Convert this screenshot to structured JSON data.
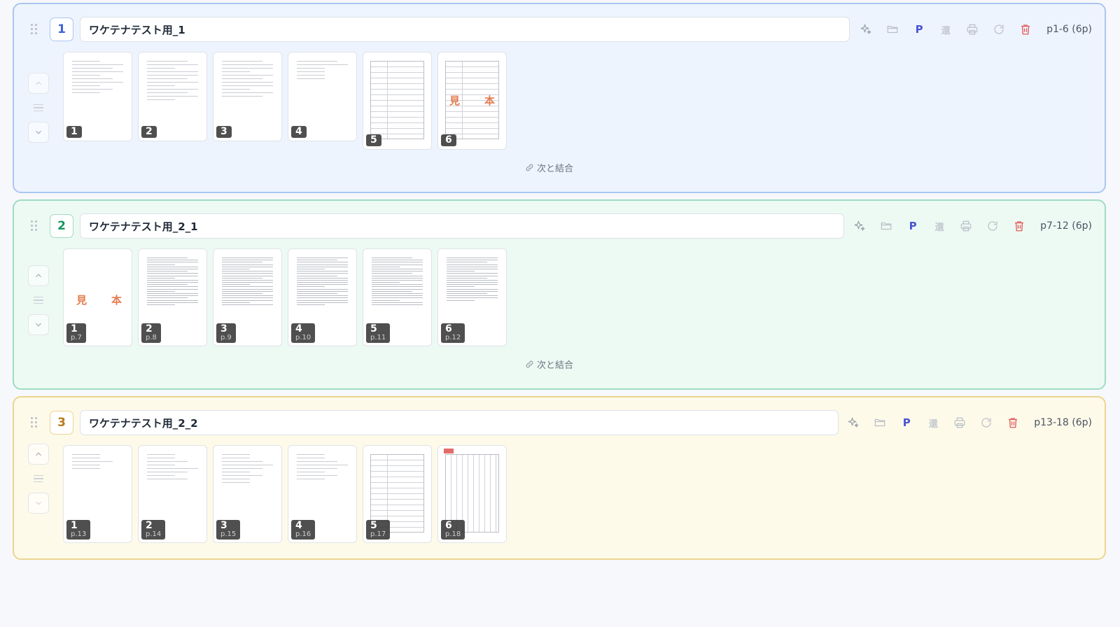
{
  "colors": {
    "blue_border": "#a9c6f3",
    "green_border": "#9fdcc0",
    "yellow_border": "#ecd58f",
    "delete": "#e25b5b",
    "p_button": "#4a55d3"
  },
  "icons": [
    "drag-handle-icon",
    "sparkle-icon",
    "folder-icon",
    "p-icon",
    "kanji-icon",
    "print-icon",
    "refresh-icon",
    "trash-icon",
    "chevron-up-icon",
    "chevron-down-icon",
    "link-icon"
  ],
  "groups": [
    {
      "number": "1",
      "name": "ワケテナテスト用_1",
      "range": "p1-6 (6p)",
      "p_label": "P",
      "kanji_label": "還",
      "join_label": "次と結合",
      "pages": [
        {
          "num": "1",
          "page": ""
        },
        {
          "num": "2",
          "page": ""
        },
        {
          "num": "3",
          "page": ""
        },
        {
          "num": "4",
          "page": ""
        },
        {
          "num": "5",
          "page": ""
        },
        {
          "num": "6",
          "page": ""
        }
      ],
      "stamps": [
        "見",
        "本"
      ]
    },
    {
      "number": "2",
      "name": "ワケテナテスト用_2_1",
      "range": "p7-12 (6p)",
      "p_label": "P",
      "kanji_label": "還",
      "join_label": "次と結合",
      "pages": [
        {
          "num": "1",
          "page": "p.7"
        },
        {
          "num": "2",
          "page": "p.8"
        },
        {
          "num": "3",
          "page": "p.9"
        },
        {
          "num": "4",
          "page": "p.10"
        },
        {
          "num": "5",
          "page": "p.11"
        },
        {
          "num": "6",
          "page": "p.12"
        }
      ],
      "stamps": [
        "見",
        "本"
      ]
    },
    {
      "number": "3",
      "name": "ワケテナテスト用_2_2",
      "range": "p13-18 (6p)",
      "p_label": "P",
      "kanji_label": "還",
      "pages": [
        {
          "num": "1",
          "page": "p.13"
        },
        {
          "num": "2",
          "page": "p.14"
        },
        {
          "num": "3",
          "page": "p.15"
        },
        {
          "num": "4",
          "page": "p.16"
        },
        {
          "num": "5",
          "page": "p.17"
        },
        {
          "num": "6",
          "page": "p.18"
        }
      ]
    }
  ]
}
